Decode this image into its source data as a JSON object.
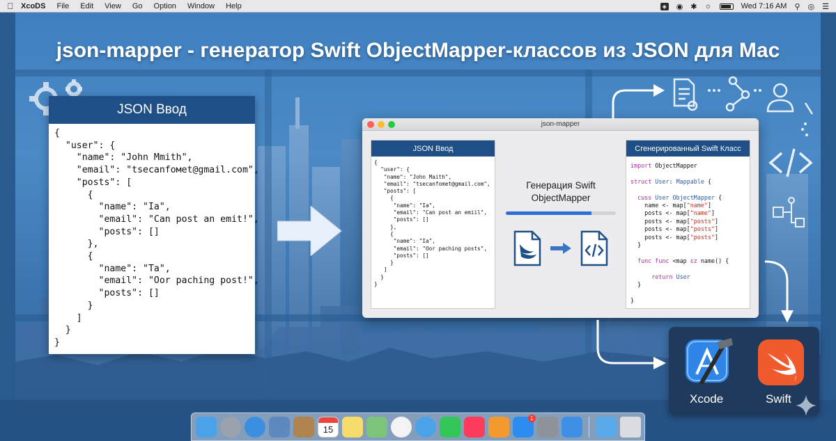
{
  "menubar": {
    "app_name": "XcoDS",
    "items": [
      "File",
      "Edit",
      "View",
      "Go",
      "Option",
      "Window",
      "Help"
    ],
    "clock": "Wed 7:16 AM"
  },
  "headline": "json-mapper - генератор Swift ObjectMapper-классов из JSON для Mac",
  "left_panel": {
    "title": "JSON Ввод",
    "code": "{\n  \"user\": {\n    \"name\": \"John Mmith\",\n    \"email\": \"tsecanfомet@gmail.com\",\n    \"posts\": [\n      {\n        \"name\": \"Ia\",\n        \"email\": \"Can post an emit!\",\n        \"posts\": []\n      },\n      {\n        \"name\": \"Ta\",\n        \"email\": \"Oor paching post!\",\n        \"posts\": []\n      }\n    ]\n  }\n}"
  },
  "window": {
    "title": "json-mapper",
    "json_panel": {
      "title": "JSON Ввод",
      "code": "{\n  \"user\": {\n   \"name\": \"John Maith\",\n   \"email\": \"tsecanfomet@gmail.com\",\n   \"posts\": [\n     {\n      \"name\": \"Ia\",\n      \"email\": \"Can post an emiil\",\n      \"posts\": []\n     },\n     {\n      \"name\": \"Ia\",\n      \"email\": \"Oor paching posts\",\n      \"posts\": []\n     }\n   ]\n  }\n}"
    },
    "generation": {
      "title": "Генерация Swift\nObjectMapper",
      "progress": 0.78
    },
    "swift_panel": {
      "title": "Сгенерированный Swift Класс",
      "lines": [
        [
          {
            "t": "import",
            "c": "kw"
          },
          {
            "t": " ObjectMapper",
            "c": ""
          }
        ],
        [],
        [
          {
            "t": "struct",
            "c": "kw"
          },
          {
            "t": " User",
            "c": "ty"
          },
          {
            "t": ": ",
            "c": ""
          },
          {
            "t": "Mappable",
            "c": "ty"
          },
          {
            "t": " {",
            "c": ""
          }
        ],
        [],
        [
          {
            "t": "  cuss",
            "c": "kw"
          },
          {
            "t": " User ObjectMapper",
            "c": "ty"
          },
          {
            "t": " {",
            "c": ""
          }
        ],
        [
          {
            "t": "    name <- map[",
            "c": ""
          },
          {
            "t": "\"name\"",
            "c": "st"
          },
          {
            "t": "]",
            "c": ""
          }
        ],
        [
          {
            "t": "    posts <- map[",
            "c": ""
          },
          {
            "t": "\"name\"",
            "c": "st"
          },
          {
            "t": "]",
            "c": ""
          }
        ],
        [
          {
            "t": "    posts <- map[",
            "c": ""
          },
          {
            "t": "\"posts\"",
            "c": "st"
          },
          {
            "t": "]",
            "c": ""
          }
        ],
        [
          {
            "t": "    posts <- map[",
            "c": ""
          },
          {
            "t": "\"posts\"",
            "c": "st"
          },
          {
            "t": "]",
            "c": ""
          }
        ],
        [
          {
            "t": "    posts <- map[",
            "c": ""
          },
          {
            "t": "\"posts\"",
            "c": "st"
          },
          {
            "t": "]",
            "c": ""
          }
        ],
        [
          {
            "t": "  }",
            "c": ""
          }
        ],
        [],
        [
          {
            "t": "  func func",
            "c": "kw"
          },
          {
            "t": " <map ",
            "c": ""
          },
          {
            "t": "ɛz",
            "c": "kw"
          },
          {
            "t": " name() {",
            "c": ""
          }
        ],
        [],
        [
          {
            "t": "      return",
            "c": "kw"
          },
          {
            "t": " User",
            "c": "ty"
          }
        ],
        [
          {
            "t": "  }",
            "c": ""
          }
        ],
        [],
        [
          {
            "t": "}",
            "c": ""
          }
        ]
      ]
    }
  },
  "apps": {
    "xcode_label": "Xcode",
    "swift_label": "Swift"
  },
  "dock": {
    "calendar_day": "15",
    "appstore_badge": "1",
    "icons": [
      {
        "name": "finder-icon",
        "color": "#4aa3e8"
      },
      {
        "name": "launchpad-icon",
        "color": "#9aa3ad"
      },
      {
        "name": "safari-icon",
        "color": "#3b8fe0"
      },
      {
        "name": "preview-icon",
        "color": "#5d89c0"
      },
      {
        "name": "contacts-icon",
        "color": "#b0844e"
      },
      {
        "name": "calendar-icon",
        "color": "#ffffff"
      },
      {
        "name": "notes-icon",
        "color": "#f6dc6a"
      },
      {
        "name": "maps-icon",
        "color": "#7cc47a"
      },
      {
        "name": "photos-icon",
        "color": "#f3f3f3"
      },
      {
        "name": "messages-icon",
        "color": "#4aa3e8"
      },
      {
        "name": "facetime-icon",
        "color": "#33c75a"
      },
      {
        "name": "music-icon",
        "color": "#fb3c5a"
      },
      {
        "name": "books-icon",
        "color": "#f29a2e"
      },
      {
        "name": "appstore-icon",
        "color": "#2d8cf0"
      },
      {
        "name": "system-preferences-icon",
        "color": "#8e9399"
      },
      {
        "name": "xcode-dock-icon",
        "color": "#3e8fe6"
      }
    ]
  }
}
